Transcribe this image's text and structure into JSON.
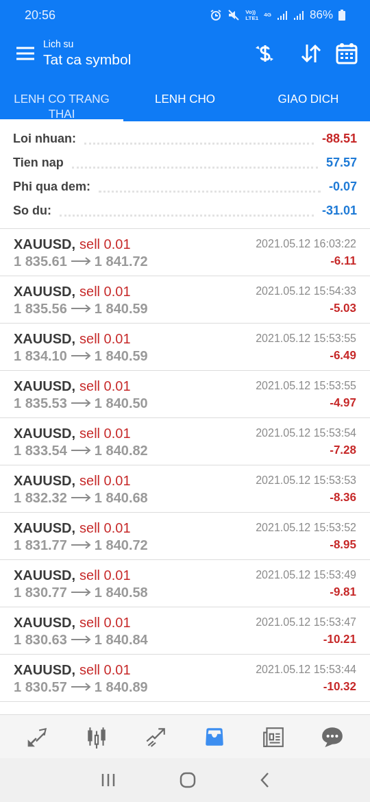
{
  "status_bar": {
    "time": "20:56",
    "network_labels": [
      "Vo))",
      "LTE1",
      "4G"
    ],
    "battery": "86%"
  },
  "header": {
    "subtitle": "Lich su",
    "title": "Tat ca symbol"
  },
  "tabs": [
    {
      "label": "LENH CO TRANG THAI",
      "selected": true
    },
    {
      "label": "LENH CHO",
      "selected": false
    },
    {
      "label": "GIAO DICH",
      "selected": false
    }
  ],
  "summary": [
    {
      "label": "Loi nhuan:",
      "value": "-88.51",
      "color": "#c62828"
    },
    {
      "label": "Tien nap",
      "value": "57.57",
      "color": "#1e7ad6"
    },
    {
      "label": "Phi qua dem:",
      "value": "-0.07",
      "color": "#1e7ad6"
    },
    {
      "label": "So du:",
      "value": "-31.01",
      "color": "#1e7ad6"
    }
  ],
  "positions": [
    {
      "symbol": "XAUUSD,",
      "side": "sell 0.01",
      "open": "1 835.61",
      "close": "1 841.72",
      "time": "2021.05.12 16:03:22",
      "profit": "-6.11"
    },
    {
      "symbol": "XAUUSD,",
      "side": "sell 0.01",
      "open": "1 835.56",
      "close": "1 840.59",
      "time": "2021.05.12 15:54:33",
      "profit": "-5.03"
    },
    {
      "symbol": "XAUUSD,",
      "side": "sell 0.01",
      "open": "1 834.10",
      "close": "1 840.59",
      "time": "2021.05.12 15:53:55",
      "profit": "-6.49"
    },
    {
      "symbol": "XAUUSD,",
      "side": "sell 0.01",
      "open": "1 835.53",
      "close": "1 840.50",
      "time": "2021.05.12 15:53:55",
      "profit": "-4.97"
    },
    {
      "symbol": "XAUUSD,",
      "side": "sell 0.01",
      "open": "1 833.54",
      "close": "1 840.82",
      "time": "2021.05.12 15:53:54",
      "profit": "-7.28"
    },
    {
      "symbol": "XAUUSD,",
      "side": "sell 0.01",
      "open": "1 832.32",
      "close": "1 840.68",
      "time": "2021.05.12 15:53:53",
      "profit": "-8.36"
    },
    {
      "symbol": "XAUUSD,",
      "side": "sell 0.01",
      "open": "1 831.77",
      "close": "1 840.72",
      "time": "2021.05.12 15:53:52",
      "profit": "-8.95"
    },
    {
      "symbol": "XAUUSD,",
      "side": "sell 0.01",
      "open": "1 830.77",
      "close": "1 840.58",
      "time": "2021.05.12 15:53:49",
      "profit": "-9.81"
    },
    {
      "symbol": "XAUUSD,",
      "side": "sell 0.01",
      "open": "1 830.63",
      "close": "1 840.84",
      "time": "2021.05.12 15:53:47",
      "profit": "-10.21"
    },
    {
      "symbol": "XAUUSD,",
      "side": "sell 0.01",
      "open": "1 830.57",
      "close": "1 840.89",
      "time": "2021.05.12 15:53:44",
      "profit": "-10.32"
    }
  ],
  "bottom_nav": [
    {
      "kind": "quotes",
      "selected": false
    },
    {
      "kind": "chart",
      "selected": false
    },
    {
      "kind": "trade",
      "selected": false
    },
    {
      "kind": "history",
      "selected": true
    },
    {
      "kind": "news",
      "selected": false
    },
    {
      "kind": "chat",
      "selected": false
    }
  ]
}
